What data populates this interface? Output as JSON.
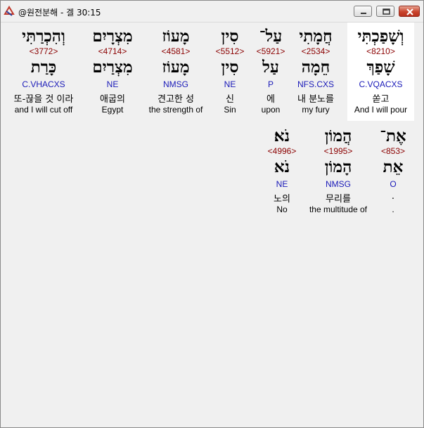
{
  "window": {
    "title": "@원전분해 - 겔 30:15"
  },
  "words": [
    {
      "heb": "וְשָׁפַכְתִּי",
      "strong": "<8210>",
      "lemma": "שָׁפַךְ",
      "grammar": "C.VQACXS",
      "korean": "쏟고",
      "english": "And I will pour"
    },
    {
      "heb": "חֲמָתִי",
      "strong": "<2534>",
      "lemma": "חֵמָה",
      "grammar": "NFS.CXS",
      "korean": "내 분노를",
      "english": "my fury"
    },
    {
      "heb": "עַל־",
      "strong": "<5921>",
      "lemma": "עַל",
      "grammar": "P",
      "korean": "에",
      "english": "upon"
    },
    {
      "heb": "סִין",
      "strong": "<5512>",
      "lemma": "סִין",
      "grammar": "NE",
      "korean": "신",
      "english": "Sin"
    },
    {
      "heb": "מָעוֹז",
      "strong": "<4581>",
      "lemma": "מָעוֹז",
      "grammar": "NMSG",
      "korean": "견고한 성",
      "english": "the strength of"
    },
    {
      "heb": "מִצְרָיִם",
      "strong": "<4714>",
      "lemma": "מִצְרַיִם",
      "grammar": "NE",
      "korean": "애굽의",
      "english": "Egypt"
    },
    {
      "heb": "וְהִכְרַתִּי",
      "strong": "<3772>",
      "lemma": "כָּרַת",
      "grammar": "C.VHACXS",
      "korean": "또-끊을 것 이라",
      "english": "and I will cut off"
    },
    {
      "heb": "אֶת־",
      "strong": "<853>",
      "lemma": "אֵת",
      "grammar": "O",
      "korean": ".",
      "english": "."
    },
    {
      "heb": "הֲמוֹן",
      "strong": "<1995>",
      "lemma": "הָמוֹן",
      "grammar": "NMSG",
      "korean": "무리를",
      "english": "the multitude of"
    },
    {
      "heb": "נֹא׃",
      "strong": "<4996>",
      "lemma": "נֹא",
      "grammar": "NE",
      "korean": "노의",
      "english": "No"
    }
  ]
}
